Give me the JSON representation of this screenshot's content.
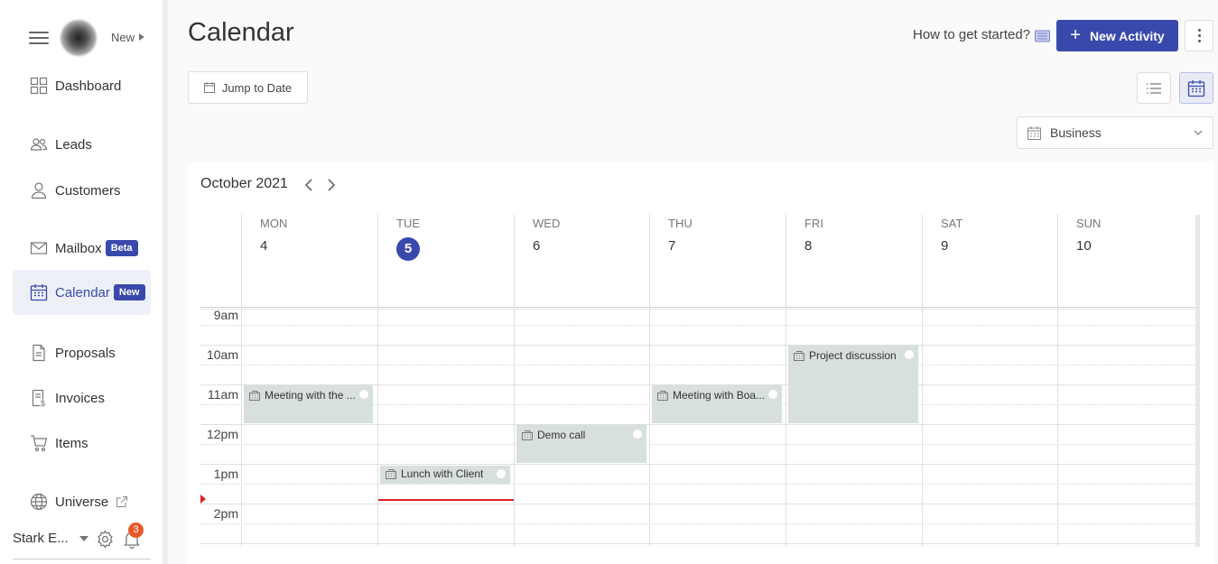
{
  "sidebar": {
    "new_label": "New",
    "items": [
      {
        "label": "Dashboard",
        "icon": "dashboard-icon"
      },
      {
        "label": "Leads",
        "icon": "users-icon"
      },
      {
        "label": "Customers",
        "icon": "user-icon"
      },
      {
        "label": "Mailbox",
        "icon": "mail-icon",
        "badge": "Beta"
      },
      {
        "label": "Calendar",
        "icon": "calendar-icon",
        "badge": "New",
        "active": true
      },
      {
        "label": "Proposals",
        "icon": "document-icon"
      },
      {
        "label": "Invoices",
        "icon": "invoice-icon"
      },
      {
        "label": "Items",
        "icon": "cart-icon"
      },
      {
        "label": "Universe",
        "icon": "globe-icon",
        "external": true
      }
    ],
    "footer": {
      "user": "Stark E...",
      "notification_count": "3"
    }
  },
  "header": {
    "title": "Calendar",
    "help_text": "How to get started?",
    "new_activity_label": "New Activity",
    "jump_to_date_label": "Jump to Date",
    "calendar_select": "Business"
  },
  "calendar": {
    "month_label": "October 2021",
    "days": [
      {
        "name": "MON",
        "num": "4"
      },
      {
        "name": "TUE",
        "num": "5",
        "today": true
      },
      {
        "name": "WED",
        "num": "6"
      },
      {
        "name": "THU",
        "num": "7"
      },
      {
        "name": "FRI",
        "num": "8"
      },
      {
        "name": "SAT",
        "num": "9"
      },
      {
        "name": "SUN",
        "num": "10"
      }
    ],
    "times": [
      "9am",
      "10am",
      "11am",
      "12pm",
      "1pm",
      "2pm"
    ],
    "events": [
      {
        "title": "Meeting with the ...",
        "day": "MON",
        "start": "11am",
        "end": "12pm"
      },
      {
        "title": "Lunch with Client",
        "day": "TUE",
        "start": "1pm",
        "end": "1:30pm"
      },
      {
        "title": "Demo call",
        "day": "WED",
        "start": "12pm",
        "end": "1pm"
      },
      {
        "title": "Meeting with Boa...",
        "day": "THU",
        "start": "11am",
        "end": "12pm"
      },
      {
        "title": "Project discussion",
        "day": "FRI",
        "start": "10am",
        "end": "12pm"
      }
    ]
  },
  "colors": {
    "accent": "#3949ab",
    "event_bg": "#d8e0dc",
    "now_line": "#dd2222",
    "notification": "#e55a2b"
  }
}
